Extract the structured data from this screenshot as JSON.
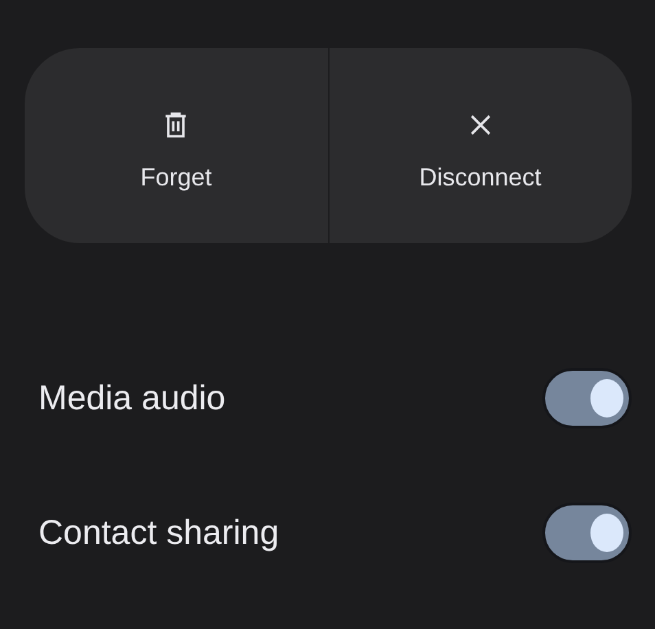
{
  "actions": [
    {
      "kind": "trash",
      "label": "Forget"
    },
    {
      "kind": "close",
      "label": "Disconnect"
    }
  ],
  "settings": [
    {
      "label": "Media audio",
      "on": true
    },
    {
      "label": "Contact sharing",
      "on": true
    }
  ]
}
